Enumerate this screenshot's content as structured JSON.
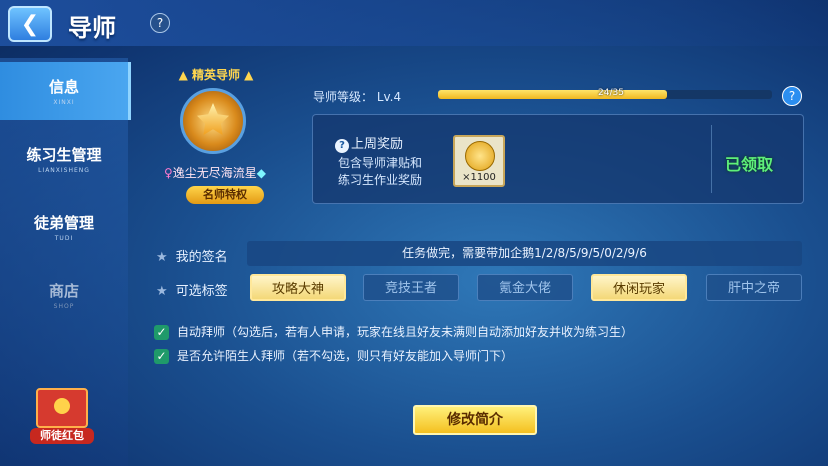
{
  "header": {
    "title": "导师",
    "help": "?"
  },
  "sidebar": {
    "items": [
      {
        "label": "信息",
        "sub": "XINXI",
        "active": true
      },
      {
        "label": "练习生管理",
        "sub": "LIANXISHENG",
        "active": false
      },
      {
        "label": "徒弟管理",
        "sub": "TUDI",
        "active": false
      },
      {
        "label": "商店",
        "sub": "SHOP",
        "active": false
      }
    ],
    "redpack_label": "师徒红包"
  },
  "mentor": {
    "elite_title": "精英导师",
    "name": "逸尘无尽海流星",
    "privilege_label": "名师特权"
  },
  "level": {
    "label": "导师等级： Lv.4",
    "progress_text": "24/35",
    "progress_fraction": 0.6857,
    "help": "?"
  },
  "reward": {
    "title": "上周奖励",
    "desc_line1": "包含导师津贴和",
    "desc_line2": "练习生作业奖励",
    "item_qty": "×1100",
    "status": "已领取"
  },
  "signature": {
    "label": "我的签名",
    "value": "任务做完，需要带加企鹅1/2/8/5/9/5/0/2/9/6"
  },
  "tags": {
    "label": "可选标签",
    "items": [
      {
        "label": "攻略大神",
        "selected": true
      },
      {
        "label": "竞技王者",
        "selected": false
      },
      {
        "label": "氪金大佬",
        "selected": false
      },
      {
        "label": "休闲玩家",
        "selected": true
      },
      {
        "label": "肝中之帝",
        "selected": false
      }
    ]
  },
  "options": {
    "auto_accept": "自动拜师（勾选后，若有人申请，玩家在线且好友未满则自动添加好友并收为练习生）",
    "allow_strangers": "是否允许陌生人拜师（若不勾选，则只有好友能加入导师门下）"
  },
  "edit_button": "修改简介",
  "colors": {
    "accent_gold": "#ffd64f",
    "claimed_green": "#5ef07a",
    "checkbox_green": "#1f9a6a"
  }
}
